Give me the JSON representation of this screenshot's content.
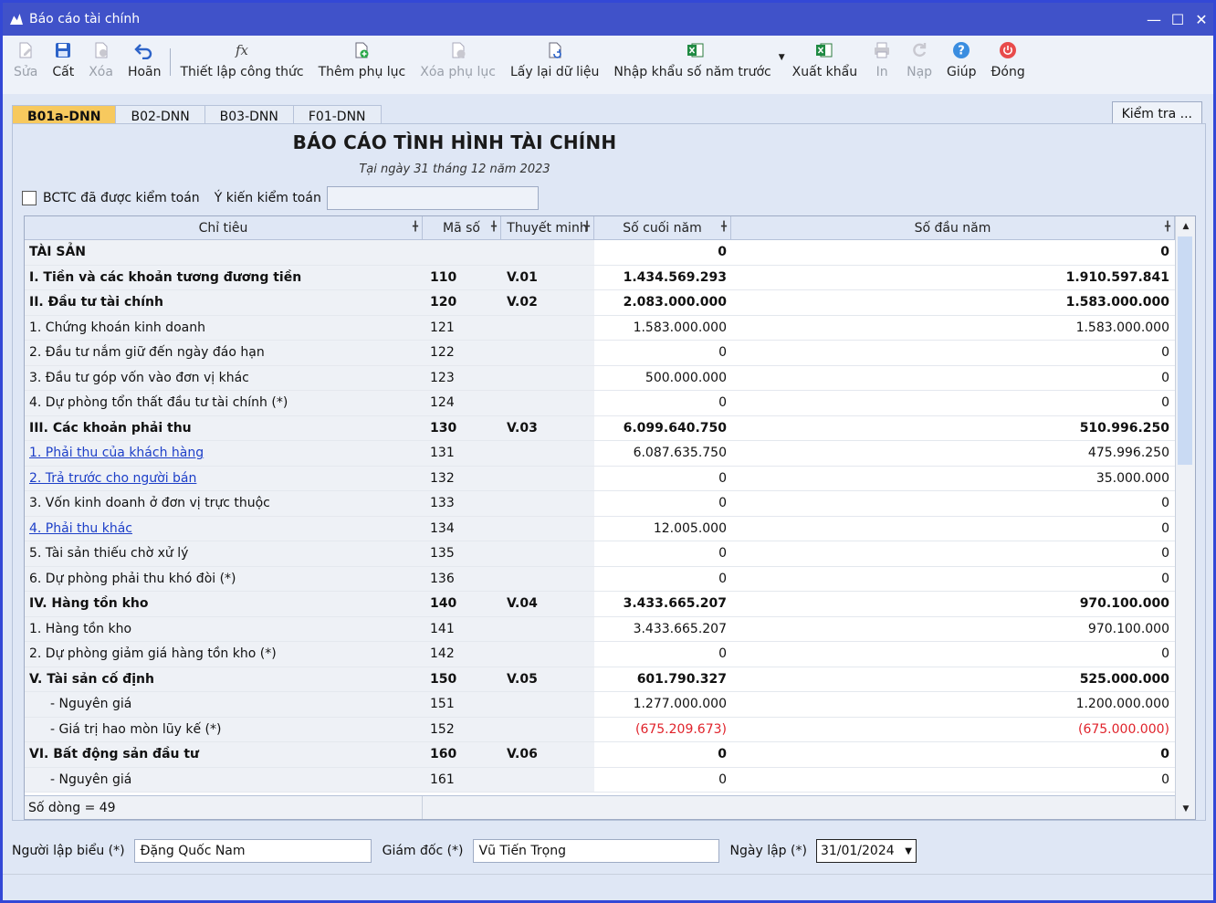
{
  "window": {
    "title": "Báo cáo tài chính"
  },
  "toolbar": {
    "items": [
      {
        "label": "Sửa",
        "icon": "edit-doc-icon",
        "disabled": true
      },
      {
        "label": "Cất",
        "icon": "save-icon",
        "disabled": false
      },
      {
        "label": "Xóa",
        "icon": "delete-doc-icon",
        "disabled": true
      },
      {
        "label": "Hoãn",
        "icon": "undo-icon",
        "disabled": false
      },
      {
        "label": "Thiết lập công thức",
        "icon": "formula-icon",
        "disabled": false
      },
      {
        "label": "Thêm phụ lục",
        "icon": "add-doc-icon",
        "disabled": false
      },
      {
        "label": "Xóa phụ lục",
        "icon": "remove-doc-icon",
        "disabled": true
      },
      {
        "label": "Lấy lại dữ liệu",
        "icon": "refresh-doc-icon",
        "disabled": false
      },
      {
        "label": "Nhập khẩu số năm trước",
        "icon": "excel-import-icon",
        "disabled": false
      },
      {
        "label": "Xuất khẩu",
        "icon": "excel-export-icon",
        "disabled": false
      },
      {
        "label": "In",
        "icon": "printer-icon",
        "disabled": true
      },
      {
        "label": "Nạp",
        "icon": "reload-icon",
        "disabled": true
      },
      {
        "label": "Giúp",
        "icon": "help-icon",
        "disabled": false
      },
      {
        "label": "Đóng",
        "icon": "power-icon",
        "disabled": false
      }
    ]
  },
  "tabs": [
    {
      "label": "B01a-DNN",
      "active": true
    },
    {
      "label": "B02-DNN",
      "active": false
    },
    {
      "label": "B03-DNN",
      "active": false
    },
    {
      "label": "F01-DNN",
      "active": false
    }
  ],
  "check_button": "Kiểm tra ...",
  "report": {
    "title": "BÁO CÁO TÌNH HÌNH TÀI CHÍNH",
    "date": "Tại ngày 31 tháng 12 năm 2023",
    "audited_label": "BCTC đã được kiểm toán",
    "audit_opinion_label": "Ý kiến kiểm toán",
    "audit_opinion_value": ""
  },
  "grid": {
    "columns": [
      "Chỉ tiêu",
      "Mã số",
      "Thuyết minh",
      "Số cuối năm",
      "Số đầu năm"
    ],
    "rows": [
      {
        "name": "TÀI SẢN",
        "code": "",
        "note": "",
        "end": "0",
        "begin": "0",
        "style": "bold"
      },
      {
        "name": "I. Tiền và các khoản tương đương tiền",
        "code": "110",
        "note": "V.01",
        "end": "1.434.569.293",
        "begin": "1.910.597.841",
        "style": "bold"
      },
      {
        "name": "II. Đầu tư tài chính",
        "code": "120",
        "note": "V.02",
        "end": "2.083.000.000",
        "begin": "1.583.000.000",
        "style": "bold"
      },
      {
        "name": "1. Chứng khoán kinh doanh",
        "code": "121",
        "note": "",
        "end": "1.583.000.000",
        "begin": "1.583.000.000",
        "style": ""
      },
      {
        "name": "2. Đầu tư nắm giữ đến ngày đáo hạn",
        "code": "122",
        "note": "",
        "end": "0",
        "begin": "0",
        "style": ""
      },
      {
        "name": "3. Đầu tư góp vốn vào đơn vị khác",
        "code": "123",
        "note": "",
        "end": "500.000.000",
        "begin": "0",
        "style": ""
      },
      {
        "name": "4. Dự phòng tổn thất đầu tư tài chính (*)",
        "code": "124",
        "note": "",
        "end": "0",
        "begin": "0",
        "style": ""
      },
      {
        "name": "III. Các khoản phải thu",
        "code": "130",
        "note": "V.03",
        "end": "6.099.640.750",
        "begin": "510.996.250",
        "style": "bold"
      },
      {
        "name": "1. Phải thu của khách hàng",
        "code": "131",
        "note": "",
        "end": "6.087.635.750",
        "begin": "475.996.250",
        "style": "link"
      },
      {
        "name": "2. Trả trước cho người bán",
        "code": "132",
        "note": "",
        "end": "0",
        "begin": "35.000.000",
        "style": "link"
      },
      {
        "name": "3. Vốn kinh doanh ở đơn vị trực thuộc",
        "code": "133",
        "note": "",
        "end": "0",
        "begin": "0",
        "style": ""
      },
      {
        "name": "4. Phải thu khác",
        "code": "134",
        "note": "",
        "end": "12.005.000",
        "begin": "0",
        "style": "link"
      },
      {
        "name": "5. Tài sản thiếu chờ xử lý",
        "code": "135",
        "note": "",
        "end": "0",
        "begin": "0",
        "style": ""
      },
      {
        "name": "6. Dự phòng phải thu khó đòi (*)",
        "code": "136",
        "note": "",
        "end": "0",
        "begin": "0",
        "style": ""
      },
      {
        "name": "IV. Hàng tồn kho",
        "code": "140",
        "note": "V.04",
        "end": "3.433.665.207",
        "begin": "970.100.000",
        "style": "bold"
      },
      {
        "name": "1. Hàng tồn kho",
        "code": "141",
        "note": "",
        "end": "3.433.665.207",
        "begin": "970.100.000",
        "style": ""
      },
      {
        "name": "2. Dự phòng giảm giá hàng tồn kho (*)",
        "code": "142",
        "note": "",
        "end": "0",
        "begin": "0",
        "style": ""
      },
      {
        "name": "V. Tài sản cố định",
        "code": "150",
        "note": "V.05",
        "end": "601.790.327",
        "begin": "525.000.000",
        "style": "bold"
      },
      {
        "name": "- Nguyên giá",
        "code": "151",
        "note": "",
        "end": "1.277.000.000",
        "begin": "1.200.000.000",
        "style": "indent"
      },
      {
        "name": "- Giá trị hao mòn lũy kế (*)",
        "code": "152",
        "note": "",
        "end": "(675.209.673)",
        "begin": "(675.000.000)",
        "style": "indent-neg"
      },
      {
        "name": "VI. Bất động sản đầu tư",
        "code": "160",
        "note": "V.06",
        "end": "0",
        "begin": "0",
        "style": "bold"
      },
      {
        "name": "- Nguyên giá",
        "code": "161",
        "note": "",
        "end": "0",
        "begin": "0",
        "style": "indent"
      }
    ],
    "footer": "Số dòng = 49"
  },
  "signers": {
    "preparer_label": "Người lập biểu (*)",
    "preparer_value": "Đặng Quốc Nam",
    "director_label": "Giám đốc (*)",
    "director_value": "Vũ Tiến Trọng",
    "date_label": "Ngày lập (*)",
    "date_value": "31/01/2024"
  },
  "colors": {
    "title_bar": "#4052c9",
    "active_tab": "#f7c95e",
    "link": "#1d3fc8",
    "negative": "#e0232b"
  }
}
